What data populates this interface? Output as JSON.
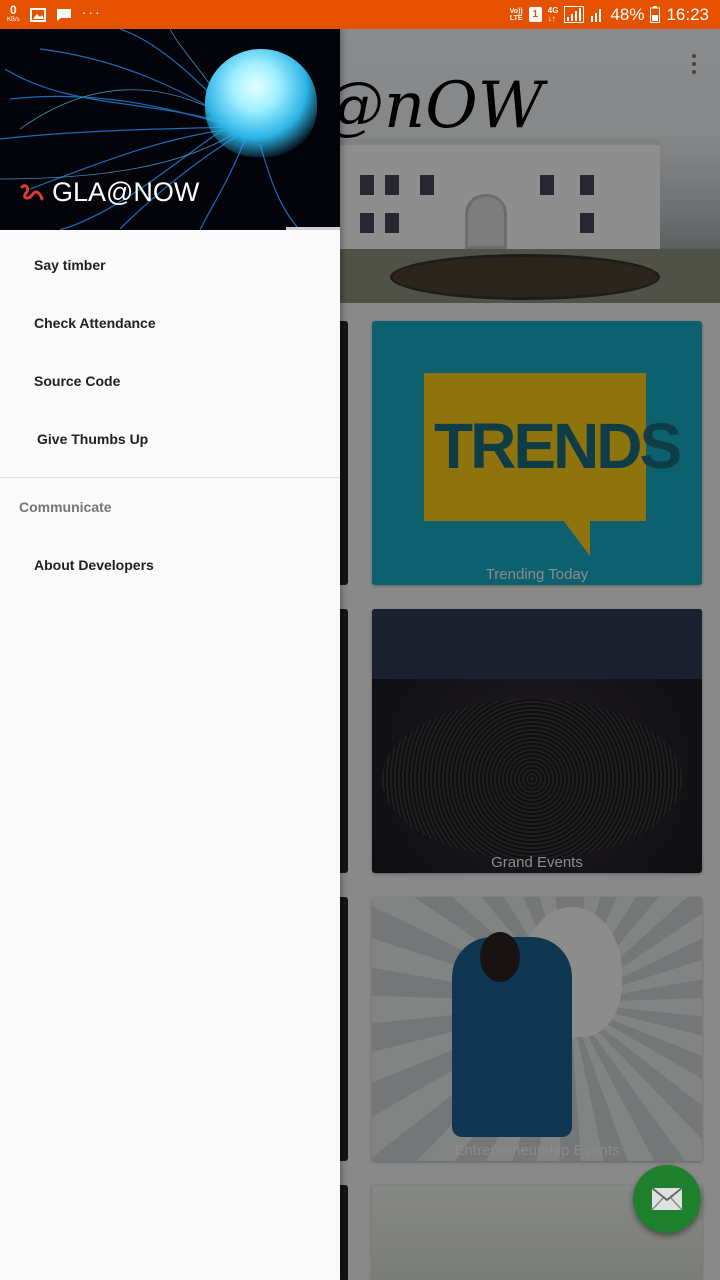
{
  "status_bar": {
    "data_speed_value": "0",
    "data_speed_unit": "KB/s",
    "overflow": "···",
    "volte_top": "Vo))",
    "volte_bottom": "LTE",
    "sim": "1",
    "network": "4G",
    "network_sub": "↓↑",
    "battery": "48%",
    "time": "16:23",
    "background_color": "#e65100"
  },
  "app": {
    "header_title": "@nOW",
    "cards": [
      {
        "caption": "Trending Today",
        "image": "trends-speech-bubble"
      },
      {
        "caption": "Grand Events",
        "image": "crowd-stage"
      },
      {
        "caption": "Entrepreneurship Events",
        "image": "bulb-person"
      },
      {
        "caption": "",
        "image": "partial-card"
      }
    ],
    "trends_text": "TRENDS",
    "fab_icon": "mail-icon",
    "fab_color": "#1e7f2c"
  },
  "drawer": {
    "header_title": "GLA@NOW",
    "header_logo_icon": "brand-squiggle-icon",
    "items": [
      {
        "label": "Say timber"
      },
      {
        "label": "Check Attendance"
      },
      {
        "label": "Source Code"
      },
      {
        "label": "Give Thumbs Up"
      }
    ],
    "section": {
      "title": "Communicate",
      "items": [
        {
          "label": "About Developers"
        }
      ]
    }
  }
}
